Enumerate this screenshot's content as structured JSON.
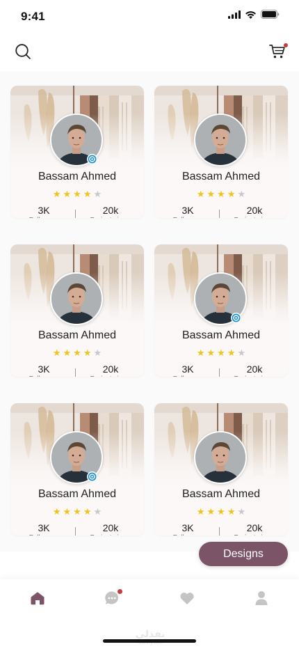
{
  "status_bar": {
    "time": "9:41"
  },
  "header": {
    "search_icon": "search-icon",
    "cart_icon": "cart-icon",
    "cart_has_notification": true
  },
  "profiles": [
    {
      "name": "Bassam Ahmed",
      "rating": 4,
      "max_rating": 5,
      "verified": true,
      "followers_value": "3K",
      "followers_label": "Followers",
      "views_value": "20k",
      "views_label": "Project views"
    },
    {
      "name": "Bassam Ahmed",
      "rating": 4,
      "max_rating": 5,
      "verified": false,
      "followers_value": "3K",
      "followers_label": "Followers",
      "views_value": "20k",
      "views_label": "Project views"
    },
    {
      "name": "Bassam Ahmed",
      "rating": 4,
      "max_rating": 5,
      "verified": false,
      "followers_value": "3K",
      "followers_label": "Followers",
      "views_value": "20k",
      "views_label": "Project views"
    },
    {
      "name": "Bassam Ahmed",
      "rating": 4,
      "max_rating": 5,
      "verified": true,
      "followers_value": "3K",
      "followers_label": "Followers",
      "views_value": "20k",
      "views_label": "Project views"
    },
    {
      "name": "Bassam Ahmed",
      "rating": 4,
      "max_rating": 5,
      "verified": true,
      "followers_value": "3K",
      "followers_label": "Followers",
      "views_value": "20k",
      "views_label": "Project views"
    },
    {
      "name": "Bassam Ahmed",
      "rating": 4,
      "max_rating": 5,
      "verified": false,
      "followers_value": "3K",
      "followers_label": "Followers",
      "views_value": "20k",
      "views_label": "Project views"
    }
  ],
  "designs_button": {
    "label": "Designs"
  },
  "bottom_nav": {
    "items": [
      {
        "icon": "home-icon",
        "active": true
      },
      {
        "icon": "chat-icon",
        "active": false,
        "has_notification": true
      },
      {
        "icon": "heart-icon",
        "active": false
      },
      {
        "icon": "profile-icon",
        "active": false
      }
    ]
  },
  "watermark": {
    "text": "نفذلي",
    "sub": "nafezly.com"
  },
  "colors": {
    "accent": "#7b5468",
    "home_active": "#7b5468",
    "nav_inactive": "#c4c4c4",
    "star_on": "#f0c419",
    "star_off": "#c8c8c8",
    "verified": "#1e8fd1",
    "notification": "#c93a3a"
  }
}
